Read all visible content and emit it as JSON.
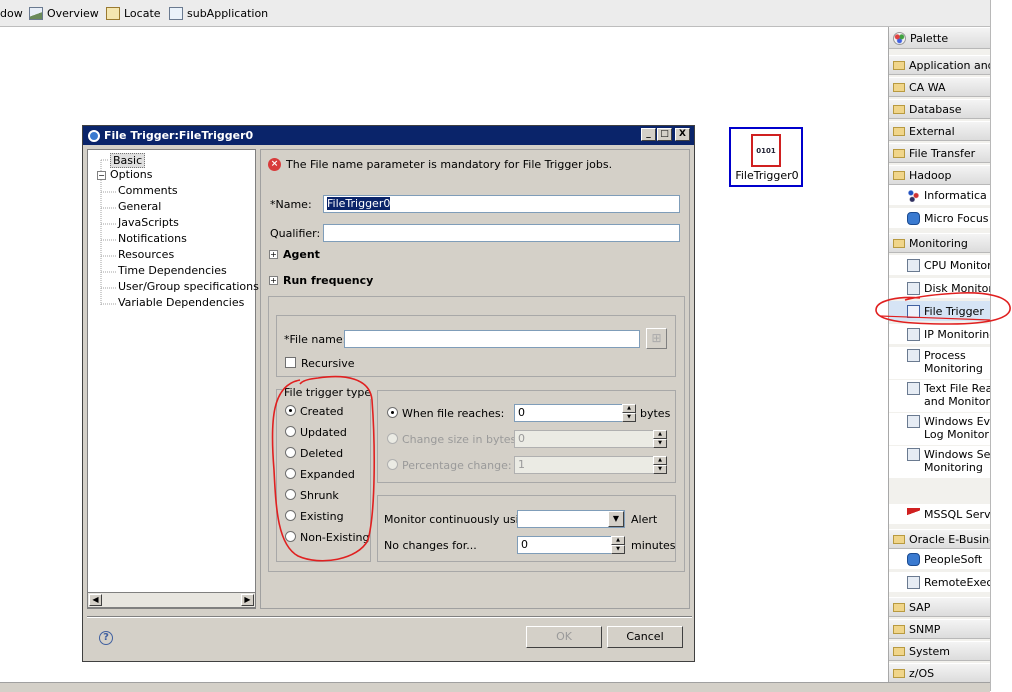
{
  "toolbar": {
    "items": [
      {
        "label": "dow",
        "icon": "window-icon"
      },
      {
        "label": "Overview",
        "icon": "overview-icon"
      },
      {
        "label": "Locate",
        "icon": "locate-icon"
      },
      {
        "label": "subApplication",
        "icon": "subapplication-icon"
      }
    ]
  },
  "canvas": {
    "node": {
      "icon_text": "0101",
      "label": "FileTrigger0"
    }
  },
  "palette": {
    "header": "Palette",
    "rows": [
      {
        "type": "cat",
        "label": "Application and \\"
      },
      {
        "type": "cat",
        "label": "CA WA"
      },
      {
        "type": "cat",
        "label": "Database"
      },
      {
        "type": "cat",
        "label": "External"
      },
      {
        "type": "cat",
        "label": "File Transfer"
      },
      {
        "type": "cat",
        "label": "Hadoop"
      },
      {
        "type": "item",
        "label": "Informatica"
      },
      {
        "type": "item",
        "label": "Micro Focus"
      },
      {
        "type": "cat",
        "label": "Monitoring"
      },
      {
        "type": "item",
        "label": "CPU Monitorir"
      },
      {
        "type": "item",
        "label": "Disk Monitorir"
      },
      {
        "type": "item",
        "label": "File Trigger"
      },
      {
        "type": "item",
        "label": "IP Monitoring"
      },
      {
        "type": "item2",
        "label": "Process",
        "label2": "Monitoring"
      },
      {
        "type": "item2",
        "label": "Text File Reac",
        "label2": "and Monitorin"
      },
      {
        "type": "item2",
        "label": "Windows Eve",
        "label2": "Log Monitorin"
      },
      {
        "type": "item2",
        "label": "Windows Serv",
        "label2": "Monitoring"
      },
      {
        "type": "item",
        "label": "MSSQL Serve"
      },
      {
        "type": "cat",
        "label": "Oracle E-Busines"
      },
      {
        "type": "item",
        "label": "PeopleSoft"
      },
      {
        "type": "item",
        "label": "RemoteExecu"
      },
      {
        "type": "cat",
        "label": "SAP"
      },
      {
        "type": "cat",
        "label": "SNMP"
      },
      {
        "type": "cat",
        "label": "System"
      },
      {
        "type": "cat",
        "label": "z/OS"
      }
    ]
  },
  "dialog": {
    "title": "File Trigger:FileTrigger0",
    "window_buttons": {
      "minimize": "_",
      "maximize": "□",
      "close": "X"
    },
    "tree": {
      "root": "Basic",
      "options": "Options",
      "children": [
        "Comments",
        "General",
        "JavaScripts",
        "Notifications",
        "Resources",
        "Time Dependencies",
        "User/Group specifications",
        "Variable Dependencies"
      ]
    },
    "error_message": "The File name parameter is mandatory for File Trigger jobs.",
    "name_label": "*Name:",
    "name_value": "FileTrigger0",
    "qualifier_label": "Qualifier:",
    "qualifier_value": "",
    "agent_label": "Agent",
    "run_frequency_label": "Run frequency",
    "file_name_label": "*File name:",
    "file_name_value": "",
    "recursive_label": "Recursive",
    "trigger_type": {
      "title": "File trigger type",
      "options": [
        "Created",
        "Updated",
        "Deleted",
        "Expanded",
        "Shrunk",
        "Existing",
        "Non-Existing"
      ],
      "selected": "Created"
    },
    "size": {
      "when_reaches_label": "When file reaches:",
      "when_reaches_value": "0",
      "bytes_label": "bytes",
      "change_size_label": "Change size in bytes:",
      "change_size_value": "0",
      "percentage_label": "Percentage change:",
      "percentage_value": "1"
    },
    "monitor": {
      "continuous_label": "Monitor continuously using",
      "continuous_value": "",
      "alert_label": "Alert",
      "no_changes_label": "No changes for...",
      "no_changes_value": "0",
      "minutes_label": "minutes"
    },
    "ok_label": "OK",
    "cancel_label": "Cancel",
    "help_label": "?"
  },
  "colors": {
    "title_bar": "#0a246a",
    "annotation": "#e02020",
    "node_border": "#0000cc",
    "error_icon": "#d83b3b"
  }
}
